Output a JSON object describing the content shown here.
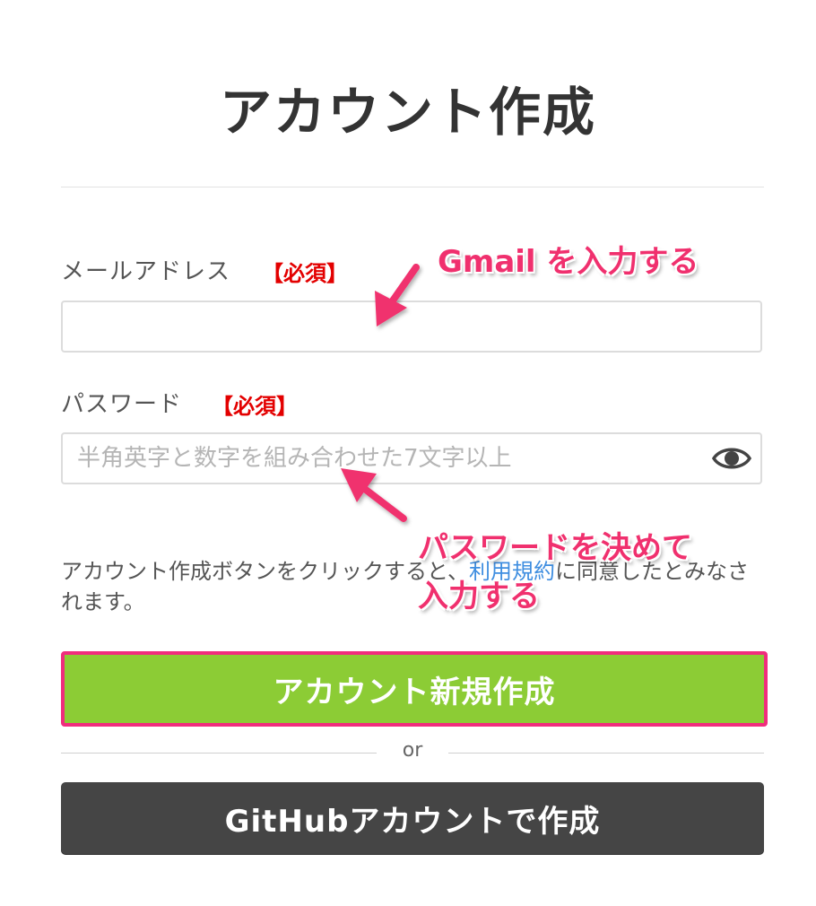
{
  "page": {
    "title": "アカウント作成"
  },
  "form": {
    "email": {
      "label": "メールアドレス",
      "required": "【必須】",
      "value": "",
      "placeholder": ""
    },
    "password": {
      "label": "パスワード",
      "required": "【必須】",
      "value": "",
      "placeholder": "半角英字と数字を組み合わせた7文字以上",
      "toggle_icon": "eye-icon"
    }
  },
  "terms": {
    "before": "アカウント作成ボタンをクリックすると、",
    "link": "利用規約",
    "after": "に同意したとみなされます。"
  },
  "buttons": {
    "create": "アカウント新規作成",
    "separator": "or",
    "github": "GitHubアカウントで作成"
  },
  "annotations": {
    "email_note": "Gmail を入力する",
    "password_note_line1": "パスワードを決めて",
    "password_note_line2": "入力する"
  },
  "colors": {
    "create_button": "#8ccc35",
    "highlight_border": "#f02d7d",
    "github_button": "#454545",
    "required": "#e30000",
    "link": "#3f8ee0",
    "annotation": "#f0306e"
  }
}
